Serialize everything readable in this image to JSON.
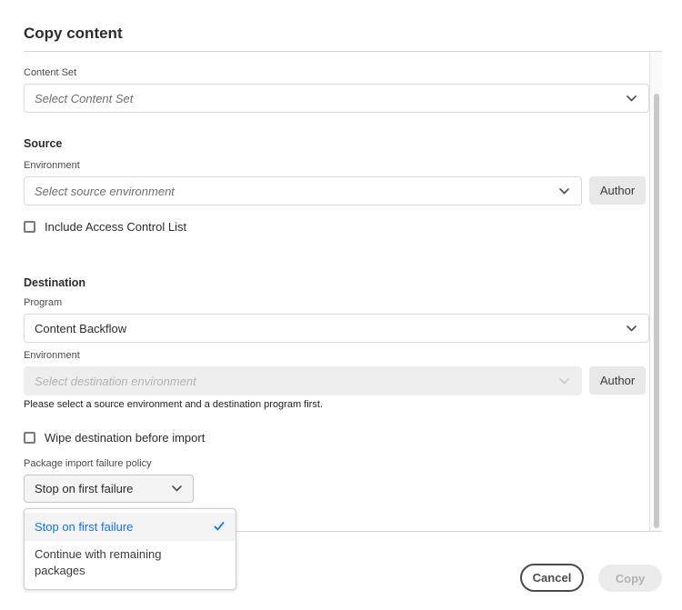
{
  "dialog": {
    "title": "Copy content"
  },
  "content_set": {
    "label": "Content Set",
    "placeholder": "Select Content Set"
  },
  "source": {
    "heading": "Source",
    "environment_label": "Environment",
    "environment_placeholder": "Select source environment",
    "tier_button": "Author",
    "acl_checkbox_label": "Include Access Control List",
    "acl_checked": false
  },
  "destination": {
    "heading": "Destination",
    "program_label": "Program",
    "program_value": "Content Backflow",
    "environment_label": "Environment",
    "environment_placeholder": "Select destination environment",
    "tier_button": "Author",
    "helper_text": "Please select a source environment and a destination program first.",
    "wipe_checkbox_label": "Wipe destination before import",
    "wipe_checked": false
  },
  "failure_policy": {
    "label": "Package import failure policy",
    "selected": "Stop on first failure",
    "options": [
      "Stop on first failure",
      "Continue with remaining packages"
    ]
  },
  "footer": {
    "cancel": "Cancel",
    "copy": "Copy"
  },
  "colors": {
    "accent": "#1473e6",
    "disabled_text": "#b3b3b3"
  },
  "icons": {
    "chevron": "chevron-down-icon",
    "check": "checkmark-icon"
  }
}
